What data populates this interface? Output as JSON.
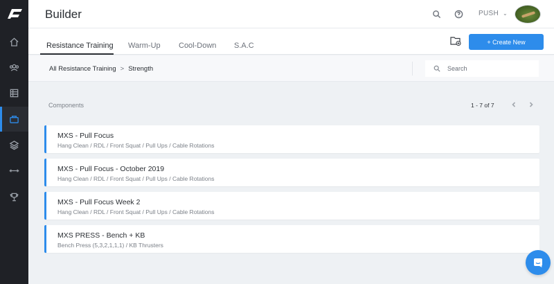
{
  "header": {
    "title": "Builder",
    "team": "PUSH",
    "icons": [
      "search-icon",
      "help-icon",
      "chevron-down-icon"
    ]
  },
  "sidebar": {
    "items": [
      {
        "icon": "home-icon"
      },
      {
        "icon": "users-icon"
      },
      {
        "icon": "table-icon"
      },
      {
        "icon": "builder-icon",
        "active": true
      },
      {
        "icon": "layers-icon"
      },
      {
        "icon": "dumbbell-icon"
      },
      {
        "icon": "trophy-icon"
      }
    ]
  },
  "tabs": [
    {
      "label": "Resistance Training",
      "active": true
    },
    {
      "label": "Warm-Up"
    },
    {
      "label": "Cool-Down"
    },
    {
      "label": "S.A.C"
    }
  ],
  "toolbar": {
    "create_label": "+ Create New",
    "folder_icon": "folder-add-icon"
  },
  "breadcrumb": {
    "root": "All Resistance Training",
    "sep": ">",
    "current": "Strength"
  },
  "search": {
    "placeholder": "Search",
    "value": ""
  },
  "components": {
    "label": "Components",
    "pager": "1 - 7 of 7",
    "items": [
      {
        "title": "MXS - Pull Focus",
        "subtitle": "Hang Clean / RDL / Front Squat / Pull Ups / Cable Rotations"
      },
      {
        "title": "MXS - Pull Focus - October 2019",
        "subtitle": "Hang Clean / RDL / Front Squat / Pull Ups / Cable Rotations"
      },
      {
        "title": "MXS - Pull Focus Week 2",
        "subtitle": "Hang Clean / RDL / Front Squat / Pull Ups / Cable Rotations"
      },
      {
        "title": "MXS PRESS - Bench + KB",
        "subtitle": "Bench Press (5,3,2,1,1,1) / KB Thrusters"
      }
    ]
  },
  "colors": {
    "accent": "#2d8ceb",
    "sidebar": "#1f2126",
    "background": "#eef1f4"
  }
}
